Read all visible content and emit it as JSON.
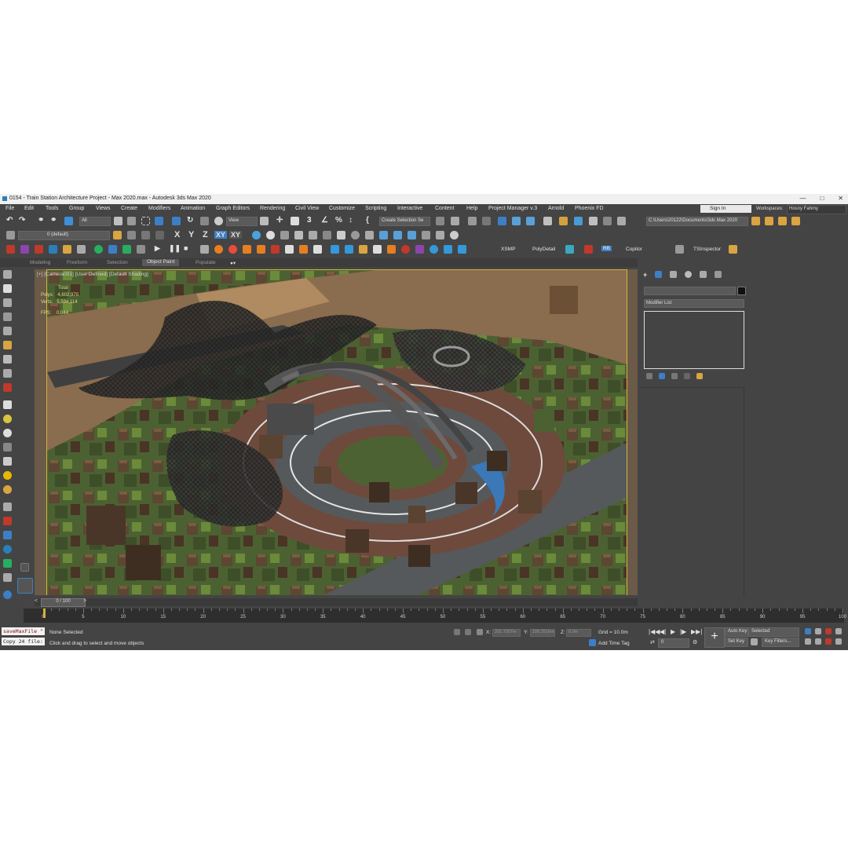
{
  "window": {
    "title": "0154 - Train Station Architecture Project - Max 2020.max - Autodesk 3ds Max 2020"
  },
  "menu": [
    "File",
    "Edit",
    "Tools",
    "Group",
    "Views",
    "Create",
    "Modifiers",
    "Animation",
    "Graph Editors",
    "Rendering",
    "Civil View",
    "Customize",
    "Scripting",
    "Interactive",
    "Content",
    "Help",
    "Project Manager v.3",
    "Arnold",
    "Phoenix FD"
  ],
  "account": {
    "sign_in": "Sign In",
    "workspaces_label": "Workspaces:",
    "workspace": "Hosny Fahmy"
  },
  "toolbar": {
    "selection_filter": "All",
    "reference_coord": "View",
    "named_selection": "Create Selection Se",
    "project_path": "C:\\Users\\20122\\Documents\\3ds Max 2020",
    "layer": "0 (default)",
    "axis_x": "X",
    "axis_y": "Y",
    "axis_z": "Z",
    "axis_xy": "XY",
    "axis_xy2": "XY",
    "xsmp": "XSMP",
    "polydetail": "PolyDetail",
    "rb": "RB",
    "copitor": "Copitor",
    "tsinspector": "TSInspector"
  },
  "ribbon": {
    "tabs": [
      "Modeling",
      "Freeform",
      "Selection",
      "Object Paint",
      "Populate"
    ],
    "active": "Object Paint"
  },
  "viewport": {
    "label": "[+] [Camera001] [User Defined] [Default Shading]",
    "stats": {
      "total_label": "Total",
      "polys_label": "Polys:",
      "polys": "4,602,970",
      "verts_label": "Verts:",
      "verts": "5,594,114",
      "fps_label": "FPS:",
      "fps": "0.044"
    }
  },
  "command_panel": {
    "modifier_list": "Modifier List"
  },
  "timeline": {
    "frame": "0 / 100",
    "ticks": [
      0,
      5,
      10,
      15,
      20,
      25,
      30,
      35,
      40,
      45,
      50,
      55,
      60,
      65,
      70,
      75,
      80,
      85,
      90,
      95,
      100
    ],
    "left_marker": "1%"
  },
  "status": {
    "script_line1": "saveMaxFile \"",
    "script_line2": "Copy 24 file:",
    "selection": "None Selected",
    "prompt": "Click and drag to select and move objects",
    "x_label": "X:",
    "x_value": "291.7267m",
    "y_label": "Y:",
    "y_value": "228.2516m",
    "z_label": "Z:",
    "z_value": "0.0m",
    "grid": "Grid = 10.0m",
    "add_time_tag": "Add Time Tag",
    "frame_field": "0",
    "auto_key": "Auto Key",
    "set_key": "Set Key",
    "key_mode": "Selected",
    "key_filters": "Key Filters..."
  },
  "colors": {
    "panel": "#444444",
    "accent_blue": "#3d7fc6",
    "viewport_border": "#d3b33b"
  }
}
